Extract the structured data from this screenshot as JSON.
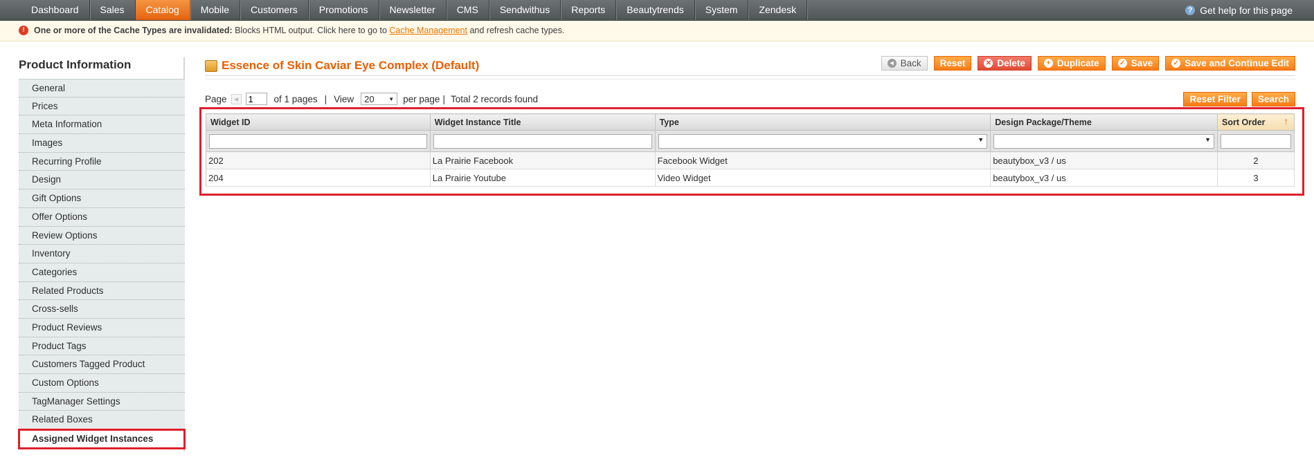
{
  "nav": {
    "items": [
      "Dashboard",
      "Sales",
      "Catalog",
      "Mobile",
      "Customers",
      "Promotions",
      "Newsletter",
      "CMS",
      "Sendwithus",
      "Reports",
      "Beautytrends",
      "System",
      "Zendesk"
    ],
    "active": "Catalog",
    "help": "Get help for this page"
  },
  "notice": {
    "bold": "One or more of the Cache Types are invalidated:",
    "text": "Blocks HTML output. Click here to go to",
    "link": "Cache Management",
    "after": "and refresh cache types."
  },
  "sidebar": {
    "title": "Product Information",
    "items": [
      "General",
      "Prices",
      "Meta Information",
      "Images",
      "Recurring Profile",
      "Design",
      "Gift Options",
      "Offer Options",
      "Review Options",
      "Inventory",
      "Categories",
      "Related Products",
      "Cross-sells",
      "Product Reviews",
      "Product Tags",
      "Customers Tagged Product",
      "Custom Options",
      "TagManager Settings",
      "Related Boxes",
      "Assigned Widget Instances"
    ]
  },
  "header": {
    "title": "Essence of Skin Caviar Eye Complex (Default)",
    "buttons": {
      "back": "Back",
      "reset": "Reset",
      "delete": "Delete",
      "duplicate": "Duplicate",
      "save": "Save",
      "save_continue": "Save and Continue Edit"
    }
  },
  "pager": {
    "page_label": "Page",
    "page_value": "1",
    "of_pages": "of 1 pages",
    "view_label": "View",
    "view_value": "20",
    "per_page": "per page",
    "total": "Total 2 records found",
    "reset_filter": "Reset Filter",
    "search": "Search"
  },
  "grid": {
    "columns": [
      "Widget ID",
      "Widget Instance Title",
      "Type",
      "Design Package/Theme",
      "Sort Order"
    ],
    "rows": [
      [
        "202",
        "La Prairie Facebook",
        "Facebook Widget",
        "beautybox_v3 / us",
        "2"
      ],
      [
        "204",
        "La Prairie Youtube",
        "Video Widget",
        "beautybox_v3 / us",
        "3"
      ]
    ]
  }
}
